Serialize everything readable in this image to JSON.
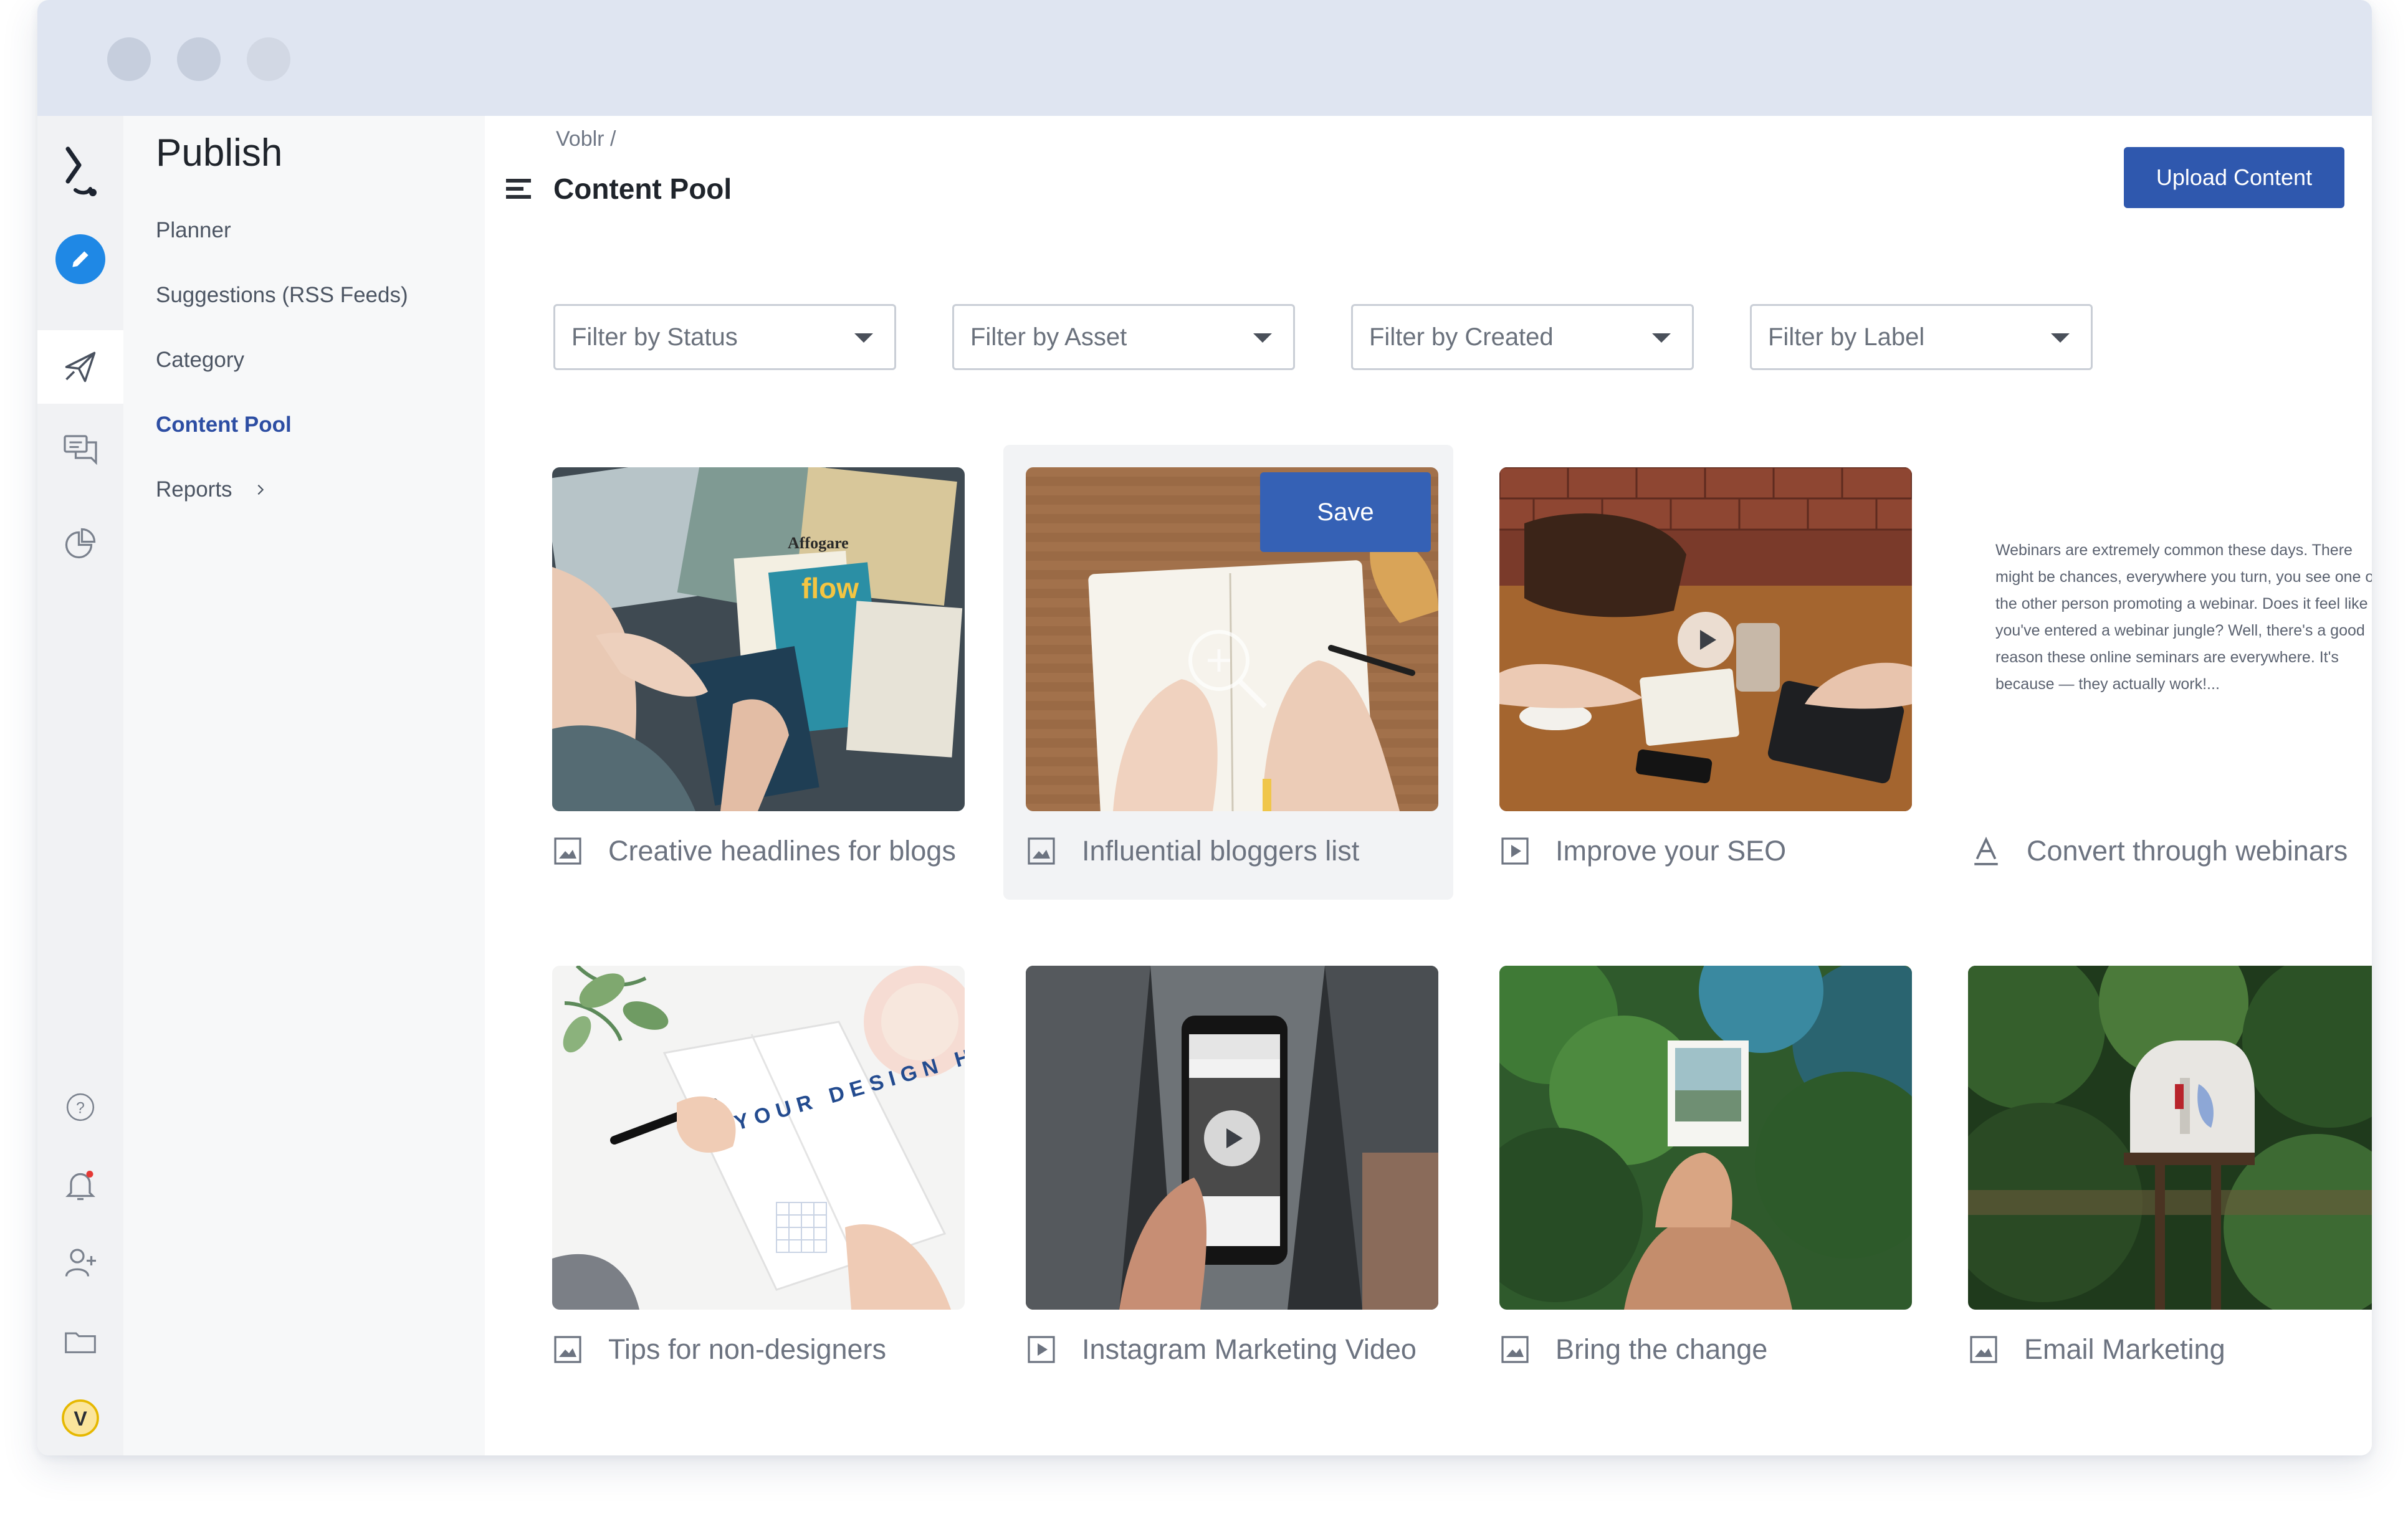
{
  "colors": {
    "accent": "#2f58ae",
    "active_nav": "#2d4ea3",
    "edit_button": "#1f88e5",
    "notification_dot": "#e53935"
  },
  "rail": {
    "items": [
      {
        "icon": "logo-icon"
      },
      {
        "icon": "edit-icon"
      },
      {
        "icon": "paper-plane-icon"
      },
      {
        "icon": "chat-icon"
      },
      {
        "icon": "pie-chart-icon"
      },
      {
        "icon": "help-icon"
      },
      {
        "icon": "bell-icon"
      },
      {
        "icon": "add-user-icon"
      },
      {
        "icon": "folder-icon"
      },
      {
        "icon": "brand-icon"
      }
    ],
    "brand_letter": "V"
  },
  "subnav": {
    "title": "Publish",
    "items": [
      {
        "label": "Planner"
      },
      {
        "label": "Suggestions (RSS Feeds)"
      },
      {
        "label": "Category"
      },
      {
        "label": "Content Pool"
      },
      {
        "label": "Reports"
      }
    ],
    "active_label": "Content Pool"
  },
  "main": {
    "breadcrumb": "Voblr /",
    "title": "Content Pool",
    "upload_label": "Upload Content",
    "filters": [
      {
        "placeholder": "Filter by Status"
      },
      {
        "placeholder": "Filter by Asset"
      },
      {
        "placeholder": "Filter by Created"
      },
      {
        "placeholder": "Filter by Label"
      }
    ],
    "save_label": "Save",
    "cards": [
      {
        "title": "Creative headlines for blogs",
        "type": "image"
      },
      {
        "title": "Influential bloggers list",
        "type": "image"
      },
      {
        "title": "Improve your SEO",
        "type": "video"
      },
      {
        "title": "Convert through webinars",
        "type": "text",
        "preview": "Webinars are extremely common these days. There might be chances, everywhere you turn, you see one or the other person promoting a webinar. Does it feel like you've entered a webinar jungle? Well, there's a good reason these online seminars are everywhere. It's because — they actually work!..."
      },
      {
        "title": "Tips for non-designers",
        "type": "image"
      },
      {
        "title": "Instagram Marketing Video",
        "type": "video"
      },
      {
        "title": "Bring the change",
        "type": "image"
      },
      {
        "title": "Email Marketing",
        "type": "image"
      }
    ],
    "thumb_texts": {
      "magazine_title": "Affogare",
      "magazine_subtitle": "flow",
      "notebook_text": "YOUR DESIGN HERE"
    }
  }
}
